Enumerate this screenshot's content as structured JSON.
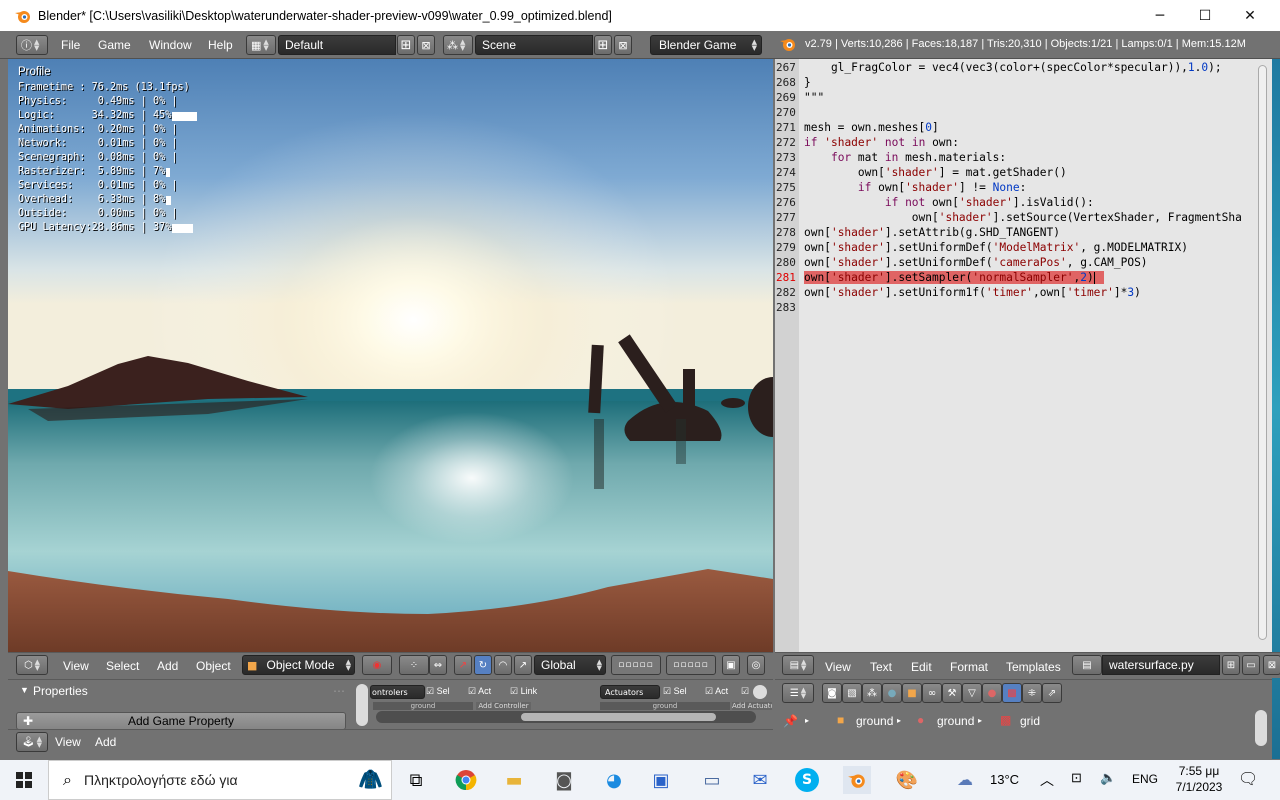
{
  "window": {
    "title": "Blender* [C:\\Users\\vasiliki\\Desktop\\waterunderwater-shader-preview-v099\\water_0.99_optimized.blend]",
    "minimize": "─",
    "maximize": "☐",
    "close": "✕"
  },
  "header": {
    "menus": [
      "File",
      "Game",
      "Window",
      "Help"
    ],
    "screen_layout": "Default",
    "scene": "Scene",
    "engine": "Blender Game",
    "stats": "v2.79 | Verts:10,286 | Faces:18,187 | Tris:20,310 | Objects:1/21 | Lamps:0/1 | Mem:15.12M"
  },
  "profile": {
    "title": "Profile",
    "rows": [
      {
        "label": "Frametime :",
        "value": " 76.2ms (13.1fps)",
        "percent": "",
        "bar": 0
      },
      {
        "label": "Physics:   ",
        "value": "  0.49ms",
        "percent": " | 0% |",
        "bar": 0
      },
      {
        "label": "Logic:     ",
        "value": " 34.32ms",
        "percent": " | 45%",
        "bar": 45
      },
      {
        "label": "Animations:",
        "value": "  0.20ms",
        "percent": " | 0% |",
        "bar": 0
      },
      {
        "label": "Network:   ",
        "value": "  0.01ms",
        "percent": " | 0% |",
        "bar": 0
      },
      {
        "label": "Scenegraph:",
        "value": "  0.08ms",
        "percent": " | 0% |",
        "bar": 0
      },
      {
        "label": "Rasterizer:",
        "value": "  5.89ms",
        "percent": " | 7%",
        "bar": 7
      },
      {
        "label": "Services:  ",
        "value": "  0.01ms",
        "percent": " | 0% |",
        "bar": 0
      },
      {
        "label": "Overhead:  ",
        "value": "  6.33ms",
        "percent": " | 8%",
        "bar": 8
      },
      {
        "label": "Outside:   ",
        "value": "  0.00ms",
        "percent": " | 0% |",
        "bar": 0
      },
      {
        "label": "GPU Latency:",
        "value": "28.86ms",
        "percent": " | 37%",
        "bar": 37
      }
    ]
  },
  "editor": {
    "lines": [
      {
        "num": "267",
        "text": "    gl_FragColor = vec4(vec3(color+(specColor*specular)),1.0);"
      },
      {
        "num": "268",
        "text": "}"
      },
      {
        "num": "269",
        "text": "\"\"\""
      },
      {
        "num": "270",
        "text": ""
      },
      {
        "num": "271",
        "text": "mesh = own.meshes[0]"
      },
      {
        "num": "272",
        "text": "if 'shader' not in own:"
      },
      {
        "num": "273",
        "text": "    for mat in mesh.materials:"
      },
      {
        "num": "274",
        "text": "        own['shader'] = mat.getShader()"
      },
      {
        "num": "275",
        "text": "        if own['shader'] != None:"
      },
      {
        "num": "276",
        "text": "            if not own['shader'].isValid():"
      },
      {
        "num": "277",
        "text": "                own['shader'].setSource(VertexShader, FragmentSha"
      },
      {
        "num": "278",
        "text": "own['shader'].setAttrib(g.SHD_TANGENT)"
      },
      {
        "num": "279",
        "text": "own['shader'].setUniformDef('ModelMatrix', g.MODELMATRIX)"
      },
      {
        "num": "280",
        "text": "own['shader'].setUniformDef('cameraPos', g.CAM_POS)"
      },
      {
        "num": "281",
        "text": "own['shader'].setSampler('normalSampler',2)"
      },
      {
        "num": "282",
        "text": "own['shader'].setUniform1f('timer',own['timer']*3)"
      },
      {
        "num": "283",
        "text": ""
      }
    ],
    "menus": [
      "View",
      "Text",
      "Edit",
      "Format",
      "Templates"
    ],
    "filename": "watersurface.py"
  },
  "view3d_header": {
    "menus": [
      "View",
      "Select",
      "Add",
      "Object"
    ],
    "mode": "Object Mode",
    "orientation": "Global"
  },
  "properties": {
    "title": "Properties",
    "add_game_property": "Add Game Property",
    "controllers": "ontrolers",
    "sel": "Sel",
    "act": "Act",
    "link": "Link",
    "actuators": "Actuators",
    "ground": "ground",
    "add_controller": "Add Controller",
    "add_actuator": "Add Actuato"
  },
  "logic_header": {
    "menus": [
      "View",
      "Add"
    ]
  },
  "props_breadcrumb": {
    "object": "ground",
    "mesh": "ground",
    "texture": "grid"
  },
  "taskbar": {
    "search_placeholder": "Πληκτρολογήστε εδώ για",
    "weather": "13°C",
    "language": "ENG",
    "time": "7:55 μμ",
    "date": "7/1/2023"
  }
}
